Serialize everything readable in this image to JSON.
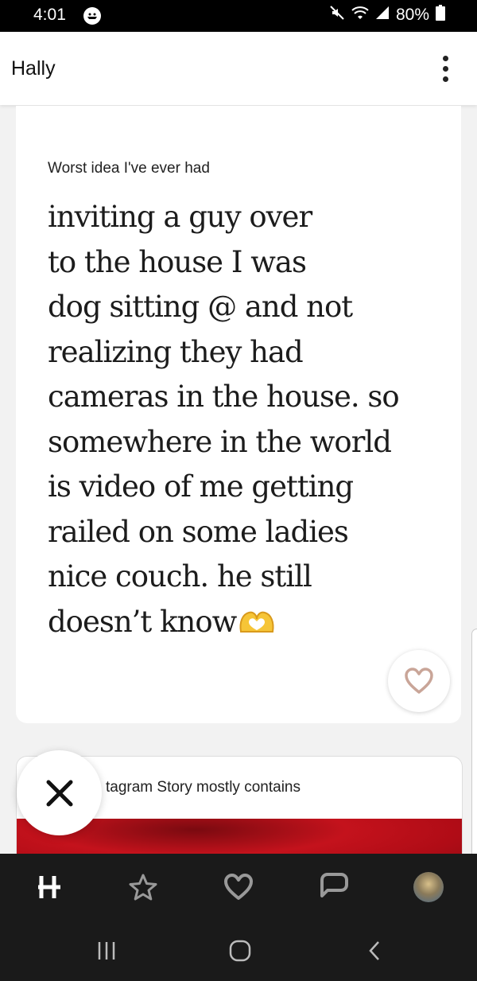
{
  "status_bar": {
    "time": "4:01",
    "battery": "80%"
  },
  "header": {
    "title": "Hally"
  },
  "answer_card": {
    "prompt": "Worst idea I've ever had",
    "answer_lines": [
      "inviting a guy over",
      "to the house I was",
      "dog sitting @ and not",
      "realizing they had",
      "cameras in the house. so",
      "somewhere in the world",
      "is video of me getting",
      "railed on some ladies",
      "nice couch. he still",
      "doesn’t know"
    ]
  },
  "second_card": {
    "prompt": "tagram Story mostly contains"
  },
  "bottom_nav": {
    "items": [
      "logo-icon",
      "star-icon",
      "heart-icon",
      "chat-icon",
      "avatar"
    ]
  },
  "system_nav": {
    "items": [
      "recents-icon",
      "home-icon",
      "back-icon"
    ]
  },
  "colors": {
    "like_heart": "#c9a598",
    "nav_background": "#1a1a1a",
    "photo_red": "#c4121c"
  }
}
